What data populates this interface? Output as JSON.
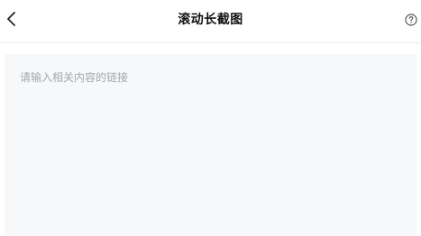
{
  "header": {
    "title": "滚动长截图",
    "back_icon": "chevron-left-icon",
    "help_icon": "question-circle-icon"
  },
  "link_input": {
    "value": "",
    "placeholder": "请输入相关内容的链接"
  },
  "colors": {
    "input_background": "#f7f8fa",
    "placeholder_text": "#a4a7ad",
    "title_text": "#111111",
    "divider": "#ececec"
  }
}
